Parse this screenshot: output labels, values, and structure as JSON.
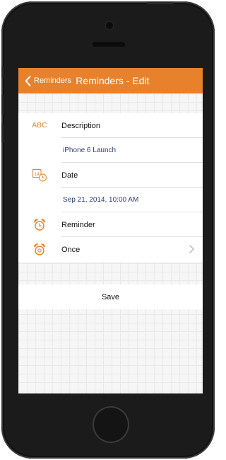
{
  "navbar": {
    "back_label": "Reminders",
    "title": "Reminders - Edit",
    "color": "#e8812c"
  },
  "form": {
    "description_icon_text": "ABC",
    "description_label": "Description",
    "description_value": "iPhone 6 Launch",
    "date_icon": "calendar-clock-icon",
    "date_icon_day": "14",
    "date_label": "Date",
    "date_value": "Sep 21, 2014, 10:00 AM",
    "reminder_icon": "alarm-clock-icon",
    "reminder_label": "Reminder",
    "repeat_icon": "alarm-clock-icon",
    "repeat_value": "Once"
  },
  "actions": {
    "save_label": "Save"
  }
}
